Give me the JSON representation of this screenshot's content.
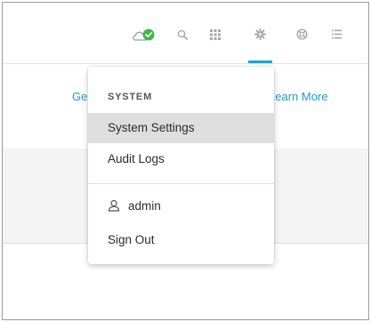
{
  "menu": {
    "section_label": "SYSTEM",
    "items": [
      {
        "label": "System Settings",
        "selected": true
      },
      {
        "label": "Audit Logs",
        "selected": false
      }
    ],
    "user": {
      "name": "admin",
      "icon": "user-icon"
    },
    "sign_out_label": "Sign Out"
  },
  "page": {
    "link_left": "Ge",
    "link_right": "Learn More"
  },
  "toolbar": {
    "icons": [
      "cloud-check-icon",
      "search-icon",
      "apps-grid-icon",
      "gear-icon",
      "help-lifebuoy-icon",
      "list-icon"
    ],
    "active_icon": "gear-icon"
  },
  "colors": {
    "accent": "#1ea2d6",
    "status_ok": "#3fb84c",
    "link": "#1f9bd1",
    "selected_bg": "#dedede"
  }
}
